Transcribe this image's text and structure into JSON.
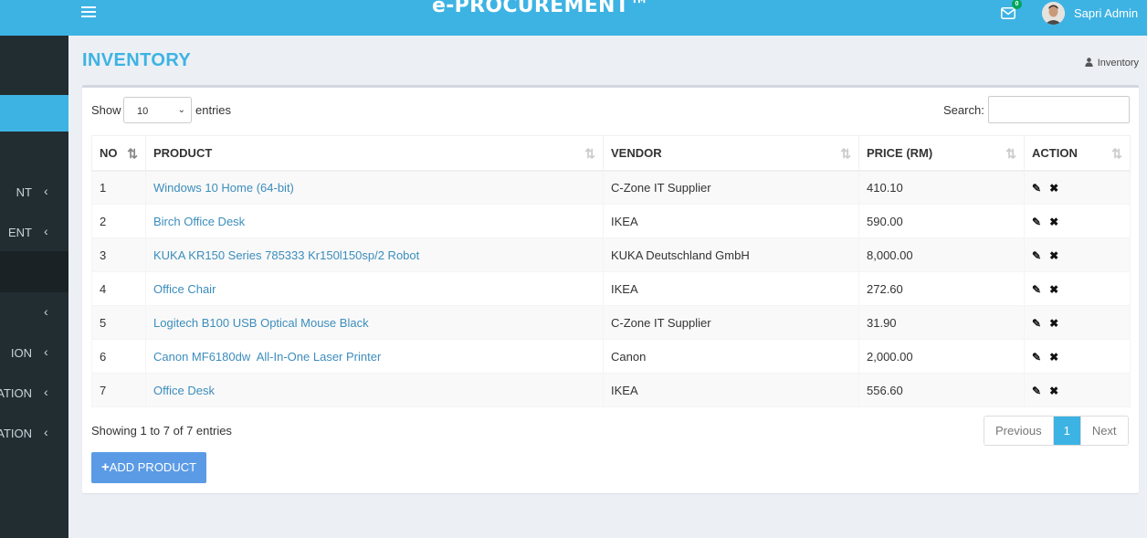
{
  "header": {
    "brand": "e-PROCUREMENT™",
    "mail_count": "0",
    "user_name": "Sapri Admin"
  },
  "sidebar": {
    "items": [
      {
        "label": "NT",
        "chevron": "‹"
      },
      {
        "label": "ENT",
        "chevron": "‹"
      },
      {
        "label": "",
        "chevron": "‹"
      },
      {
        "label": "ION",
        "chevron": "‹"
      },
      {
        "label": "RATION",
        "chevron": "‹"
      },
      {
        "label": "ATION",
        "chevron": "‹"
      }
    ]
  },
  "page": {
    "title": "INVENTORY",
    "breadcrumb": "Inventory"
  },
  "table_controls": {
    "show_label": "Show",
    "page_length": "10",
    "entries_label": "entries",
    "search_label": "Search:",
    "search_value": ""
  },
  "table": {
    "headers": [
      "NO",
      "PRODUCT",
      "VENDOR",
      "PRICE (RM)",
      "ACTION"
    ],
    "rows": [
      {
        "no": "1",
        "product": "Windows 10 Home (64-bit)",
        "vendor": "C-Zone IT Supplier",
        "price": "410.10"
      },
      {
        "no": "2",
        "product": "Birch Office Desk",
        "vendor": "IKEA",
        "price": "590.00"
      },
      {
        "no": "3",
        "product": "KUKA KR150 Series 785333 Kr150l150sp/2 Robot",
        "vendor": "KUKA Deutschland GmbH",
        "price": "8,000.00"
      },
      {
        "no": "4",
        "product": "Office Chair",
        "vendor": "IKEA",
        "price": "272.60"
      },
      {
        "no": "5",
        "product": "Logitech B100 USB Optical Mouse Black",
        "vendor": "C-Zone IT Supplier",
        "price": "31.90"
      },
      {
        "no": "6",
        "product": "Canon MF6180dw  All-In-One Laser Printer",
        "vendor": "Canon",
        "price": "2,000.00"
      },
      {
        "no": "7",
        "product": "Office Desk",
        "vendor": "IKEA",
        "price": "556.60"
      }
    ],
    "action_icons": {
      "edit": "pencil-icon",
      "delete": "close-icon"
    }
  },
  "footer": {
    "info": "Showing 1 to 7 of 7 entries",
    "pagination": {
      "previous": "Previous",
      "current": "1",
      "next": "Next"
    },
    "add_button": "ADD PRODUCT"
  },
  "colors": {
    "primary": "#3db3e3",
    "sidebar": "#222d32",
    "link": "#3c8dbc",
    "button": "#5b9be5"
  }
}
